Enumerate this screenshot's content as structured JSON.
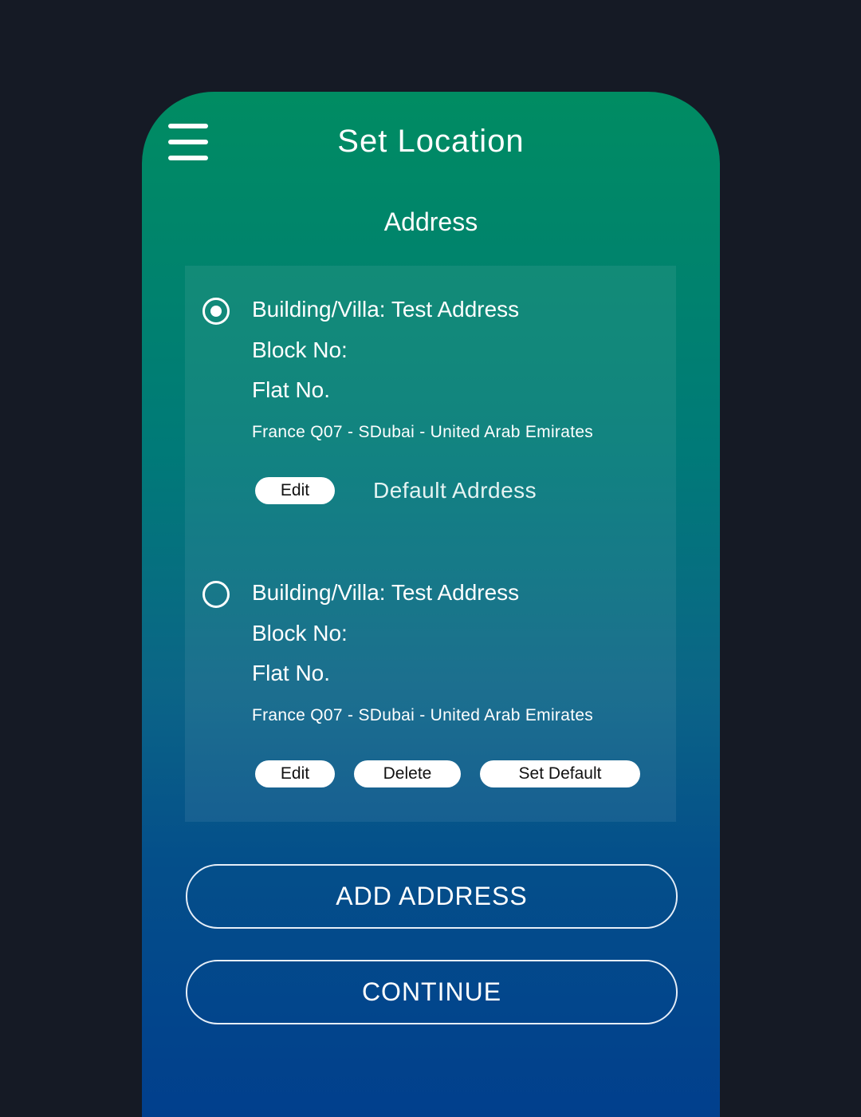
{
  "header": {
    "title": "Set Location",
    "subtitle": "Address"
  },
  "addresses": [
    {
      "selected": true,
      "building": "Building/Villa: Test Address",
      "block": "Block No:",
      "flat": "Flat No.",
      "location": "France Q07 - SDubai - United Arab Emirates",
      "edit_label": "Edit",
      "default_label": "Default Adrdess"
    },
    {
      "selected": false,
      "building": "Building/Villa: Test Address",
      "block": "Block No:",
      "flat": "Flat No.",
      "location": "France Q07 - SDubai - United Arab Emirates",
      "edit_label": "Edit",
      "delete_label": "Delete",
      "set_default_label": "Set Default"
    }
  ],
  "actions": {
    "add_address": "ADD ADDRESS",
    "continue": "CONTINUE"
  },
  "colors": {
    "background": "#151a25",
    "gradient_top": "#008c62",
    "gradient_bottom": "#013f8d"
  }
}
